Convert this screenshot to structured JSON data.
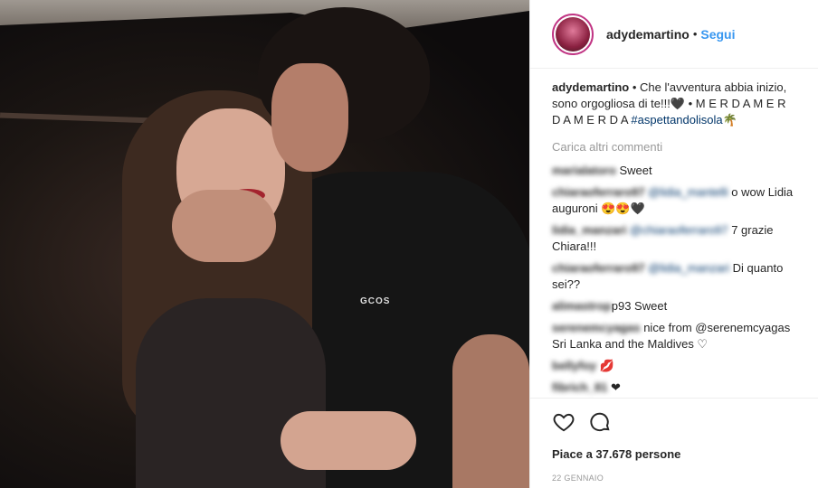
{
  "post": {
    "photo_text": "GCOS",
    "author": "adydemartino",
    "follow_label": "Segui",
    "dot": "•"
  },
  "caption": {
    "user": "adydemartino",
    "text_part1": " • Che l'avventura abbia inizio, sono orgogliosa di te!!!",
    "heart": "🖤",
    "text_part2": " • M E R D A M E R D A M E R D A ",
    "hashtag": "#aspettandolisola",
    "palm": "🌴"
  },
  "load_more_label": "Carica altri commenti",
  "comments": [
    {
      "user": "marialatoro",
      "mention": "",
      "text": "Sweet"
    },
    {
      "user": "chiaraoferraro97",
      "mention": "@lidia_mantelli",
      "text": "o wow Lidia auguroni 😍😍🖤"
    },
    {
      "user": "lidia_manzari",
      "mention": "@chiaraoferraro97",
      "text": "7 grazie Chiara!!!"
    },
    {
      "user": "chiaraoferraro97",
      "mention": "@lidia_manzari",
      "text": "Di quanto sei??"
    },
    {
      "user": "alimastrop",
      "mention": "",
      "text": "p93 Sweet"
    },
    {
      "user": "serenemcyagas",
      "mention": "",
      "text": "nice from @serenemcyagas Sri Lanka and the Maldives ♡"
    },
    {
      "user": "bellyfoy",
      "mention": "",
      "text": "💋"
    },
    {
      "user": "fibrich_81",
      "mention": "",
      "text": "❤"
    }
  ],
  "likes": "Piace a 37.678 persone",
  "date": "22 GENNAIO",
  "icons": {
    "like": "heart-icon",
    "comment": "comment-icon"
  }
}
